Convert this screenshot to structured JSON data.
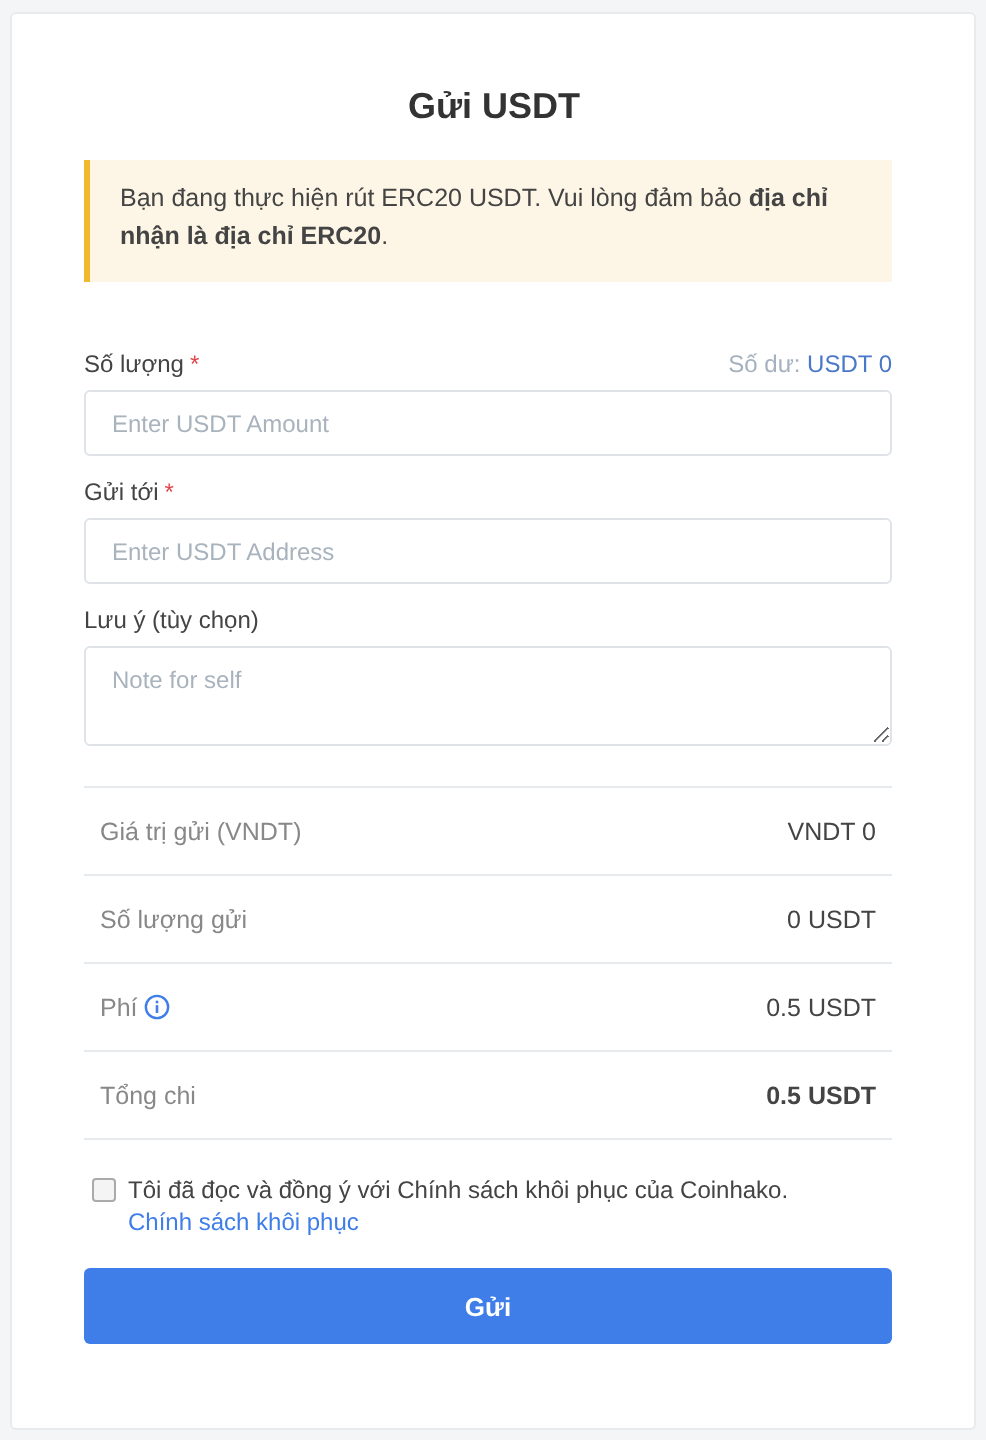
{
  "title": "Gửi USDT",
  "notice": "Bạn đang thực hiện rút ERC20 USDT. Vui lòng đảm bảo **địa chỉ nhận là địa chỉ ERC20**.",
  "required_mark": "*",
  "balance": {
    "label": "Số dư:",
    "value": "USDT 0"
  },
  "fields": [
    {
      "label": "Số lượng",
      "required": true,
      "kind": "input",
      "placeholder": "Enter USDT Amount"
    },
    {
      "label": "Gửi tới",
      "required": true,
      "kind": "input",
      "placeholder": "Enter USDT Address"
    },
    {
      "label": "Lưu ý (tùy chọn)",
      "required": false,
      "kind": "textarea",
      "placeholder": "Note for self"
    }
  ],
  "summary": [
    {
      "label": "Giá trị gửi (VNDT)",
      "value": "VNDT 0",
      "info": false,
      "bold": false
    },
    {
      "label": "Số lượng gửi",
      "value": "0 USDT",
      "info": false,
      "bold": false
    },
    {
      "label": "Phí",
      "value": "0.5 USDT",
      "info": true,
      "bold": false
    },
    {
      "label": "Tổng chi",
      "value": "0.5 USDT",
      "info": false,
      "bold": true
    }
  ],
  "agreement": {
    "checked": false,
    "text": "Tôi đã đọc và đồng ý với Chính sách khôi phục của Coinhako.",
    "link": "Chính sách khôi phục"
  },
  "submit": "Gửi"
}
